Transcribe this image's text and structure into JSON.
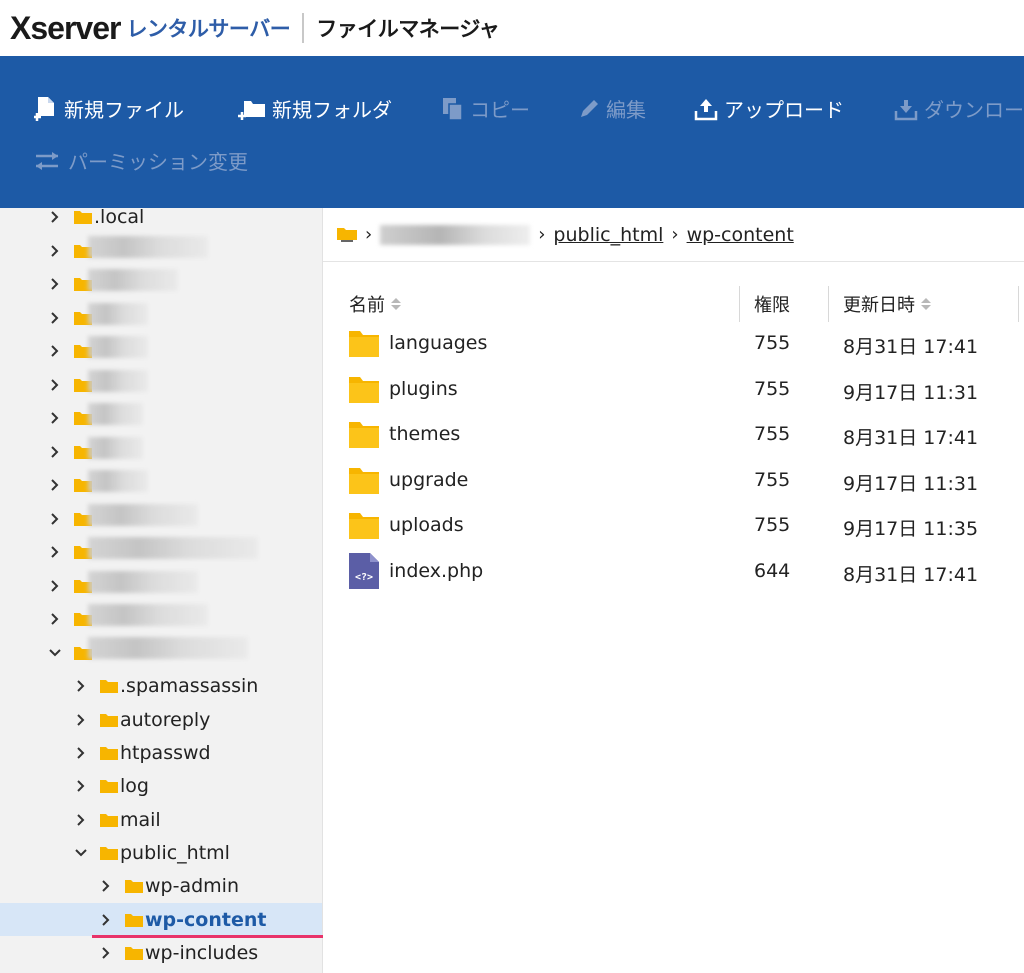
{
  "header": {
    "brand": "Xserver",
    "brand_sub": "レンタルサーバー",
    "app_title": "ファイルマネージャ"
  },
  "toolbar": {
    "new_file": "新規ファイル",
    "new_folder": "新規フォルダ",
    "copy": "コピー",
    "edit": "編集",
    "upload": "アップロード",
    "download": "ダウンロー",
    "permission": "パーミッション変更"
  },
  "sidebar": {
    "top_item": ".local",
    "children": [
      ".spamassassin",
      "autoreply",
      "htpasswd",
      "log",
      "mail",
      "public_html"
    ],
    "grandchildren": [
      "wp-admin",
      "wp-content",
      "wp-includes"
    ]
  },
  "breadcrumb": [
    "public_html",
    "wp-content"
  ],
  "table": {
    "headers": {
      "name": "名前",
      "perm": "権限",
      "date": "更新日時"
    },
    "rows": [
      {
        "name": "languages",
        "perm": "755",
        "date": "8月31日 17:41",
        "type": "folder"
      },
      {
        "name": "plugins",
        "perm": "755",
        "date": "9月17日 11:31",
        "type": "folder"
      },
      {
        "name": "themes",
        "perm": "755",
        "date": "8月31日 17:41",
        "type": "folder"
      },
      {
        "name": "upgrade",
        "perm": "755",
        "date": "9月17日 11:31",
        "type": "folder"
      },
      {
        "name": "uploads",
        "perm": "755",
        "date": "9月17日 11:35",
        "type": "folder"
      },
      {
        "name": "index.php",
        "perm": "644",
        "date": "8月31日 17:41",
        "type": "php"
      }
    ]
  },
  "colors": {
    "brand_blue": "#1d5aa6",
    "folder": "#f7b500",
    "selected": "#d7e6f7",
    "highlight": "#e8336a"
  },
  "icons": {
    "file_row": "php-file-icon",
    "folder": "folder-icon"
  },
  "php_icon_glyph": "<?>"
}
